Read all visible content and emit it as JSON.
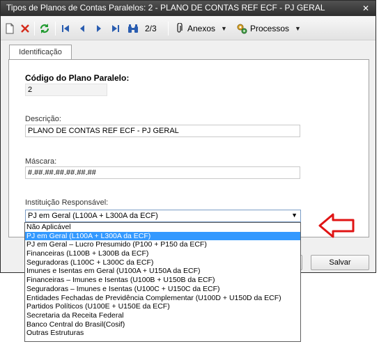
{
  "window": {
    "title": "Tipos de Planos de Contas Paralelos: 2 - PLANO DE CONTAS REF  ECF - PJ GERAL"
  },
  "toolbar": {
    "record_position": "2/3",
    "attachments_label": "Anexos",
    "processes_label": "Processos"
  },
  "tabs": [
    {
      "label": "Identificação"
    }
  ],
  "form": {
    "code_label": "Código do Plano Paralelo:",
    "code_value": "2",
    "description_label": "Descrição:",
    "description_value": "PLANO DE CONTAS REF  ECF - PJ GERAL",
    "mask_label": "Máscara:",
    "mask_value": "#.##.##.##.##.##.##",
    "institution_label": "Instituição Responsável:",
    "institution_value": "PJ em Geral (L100A + L300A da ECF)"
  },
  "dropdown": {
    "selected_index": 1,
    "options": [
      "Não Aplicável",
      "PJ em Geral (L100A + L300A da ECF)",
      "PJ em Geral – Lucro Presumido (P100 + P150 da ECF)",
      "Financeiras (L100B + L300B da ECF)",
      "Seguradoras (L100C + L300C da ECF)",
      "Imunes e Isentas em Geral (U100A + U150A da ECF)",
      "Financeiras – Imunes e Isentas (U100B + U150B da ECF)",
      "Seguradoras – Imunes e Isentas (U100C + U150C da ECF)",
      "Entidades Fechadas de Previdência Complementar (U100D + U150D da ECF)",
      "Partidos Políticos (U100E + U150E da ECF)",
      "Secretaria da Receita Federal",
      "Banco Central do Brasil(Cosif)",
      "Outras Estruturas"
    ]
  },
  "buttons": {
    "cancel_fragment": "r",
    "save_label": "Salvar"
  }
}
